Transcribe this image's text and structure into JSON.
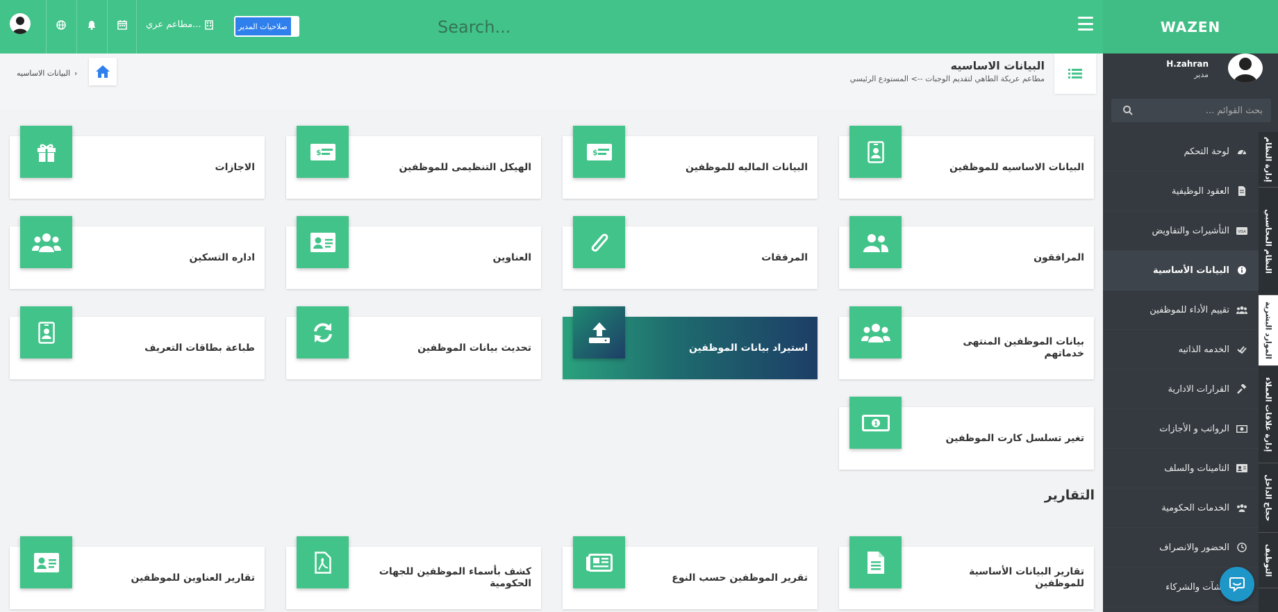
{
  "brand": "WAZEN",
  "topbar": {
    "search_placeholder": "Search...",
    "permissions_label": "صلاحيات المدير",
    "branch_label": "مطاعم عري..."
  },
  "sidebar": {
    "user_name": "H.zahran",
    "user_role": "مدير",
    "search_placeholder": "بحث القوائم ...",
    "items": [
      {
        "label": "لوحة التحكم",
        "icon": "dashboard-icon"
      },
      {
        "label": "العقود الوظيفية",
        "icon": "file-contract-icon"
      },
      {
        "label": "التأشيرات والتفاويض",
        "icon": "visa-icon"
      },
      {
        "label": "البيانات الأساسية",
        "icon": "info-circle-icon",
        "active": true
      },
      {
        "label": "تقييم الأداء للموظفين",
        "icon": "users-icon"
      },
      {
        "label": "الخدمه الذاتيه",
        "icon": "check-double-icon"
      },
      {
        "label": "القرارات الادارية",
        "icon": "gavel-icon"
      },
      {
        "label": "الرواتب و الأجازات",
        "icon": "money-icon"
      },
      {
        "label": "التامينات والسلف",
        "icon": "id-card-icon"
      },
      {
        "label": "الخدمات الحكومية",
        "icon": "users-icon"
      },
      {
        "label": "الحضور والانصراف",
        "icon": "clock-icon"
      },
      {
        "label": "منشآت والشركاء",
        "icon": "building-icon"
      }
    ],
    "tabs": [
      "إدارة النظام",
      "النظام المحاسبي",
      "الموارد البشرية",
      "إدارة علاقات العملاء",
      "حجاج الداخل",
      "التوظيف"
    ]
  },
  "page_header": {
    "title": "البيانات الاساسيه",
    "subtitle": "مطاعم عريكة الطاهي لتقديم الوجبات --> المستودع الرئيسي",
    "breadcrumb": "البيانات الاساسيه"
  },
  "cards": [
    {
      "label": "البيانات الاساسيه للموظفين",
      "icon": "id-badge-icon"
    },
    {
      "label": "البيانات الماليه للموظفين",
      "icon": "money-check-icon"
    },
    {
      "label": "الهيكل التنظيمى للموظفين",
      "icon": "money-check-icon"
    },
    {
      "label": "الاجازات",
      "icon": "gift-icon"
    },
    {
      "label": "المرافقون",
      "icon": "user-friends-icon"
    },
    {
      "label": "المرفقات",
      "icon": "paperclip-icon"
    },
    {
      "label": "العناوين",
      "icon": "address-card-icon"
    },
    {
      "label": "اداره التسكين",
      "icon": "users-icon"
    },
    {
      "label": "بيانات الموظفين المنتهى خدماتهم",
      "icon": "users-icon"
    },
    {
      "label": "استيراد بيانات الموظفين",
      "icon": "upload-icon",
      "highlight": true
    },
    {
      "label": "تحديث بيانات الموظفين",
      "icon": "sync-icon"
    },
    {
      "label": "طباعة بطاقات التعريف",
      "icon": "id-badge-icon"
    },
    {
      "label": "تغير تسلسل كارت الموظفين",
      "icon": "money-bill-icon"
    }
  ],
  "reports_title": "التقارير",
  "reports": [
    {
      "label": "تقارير البيانات الأساسية للموظفين",
      "icon": "file-alt-icon"
    },
    {
      "label": "تقرير الموظفين حسب النوع",
      "icon": "newspaper-icon"
    },
    {
      "label": "كشف بأسماء الموظفين للجهات الحكومية",
      "icon": "file-pdf-icon"
    },
    {
      "label": "تقارير العناوين للموظفين",
      "icon": "address-card-icon"
    }
  ],
  "colors": {
    "primary": "#42c38a",
    "sidebar": "#343a40",
    "highlight_gradient_end": "#1d3e66"
  }
}
